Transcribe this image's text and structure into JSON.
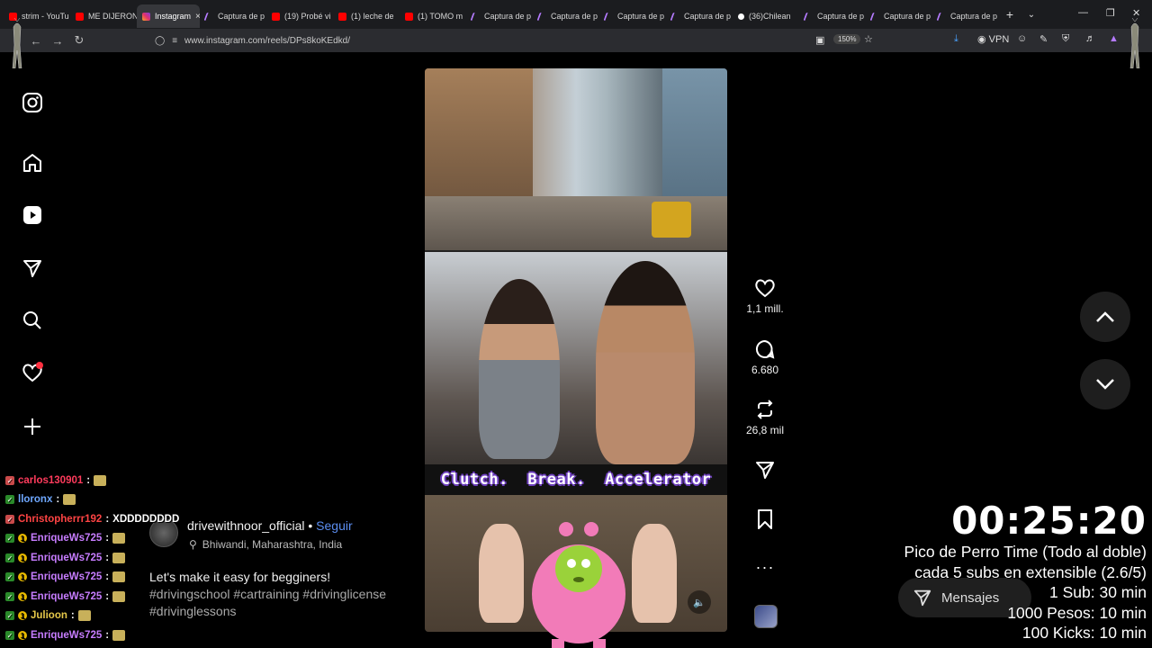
{
  "browser": {
    "tabs": [
      {
        "title": "strim - YouTu",
        "icon": "youtube-icon",
        "kind": "yt"
      },
      {
        "title": "ME DIJERON",
        "icon": "youtube-icon",
        "kind": "yt"
      },
      {
        "title": "Instagram",
        "icon": "instagram-icon",
        "kind": "ig",
        "active": true
      },
      {
        "title": "Captura de p",
        "icon": "pen-icon",
        "kind": "pen"
      },
      {
        "title": "(19) Probé vi",
        "icon": "youtube-icon",
        "kind": "yt"
      },
      {
        "title": "(1) leche de",
        "icon": "youtube-icon",
        "kind": "yt"
      },
      {
        "title": "(1) TOMO m",
        "icon": "youtube-icon",
        "kind": "yt"
      },
      {
        "title": "Captura de p",
        "icon": "pen-icon",
        "kind": "pen"
      },
      {
        "title": "Captura de p",
        "icon": "pen-icon",
        "kind": "pen"
      },
      {
        "title": "Captura de p",
        "icon": "pen-icon",
        "kind": "pen"
      },
      {
        "title": "Captura de p",
        "icon": "pen-icon",
        "kind": "pen"
      },
      {
        "title": "(36)Chilean",
        "icon": "tiktok-icon",
        "kind": "tt"
      },
      {
        "title": "Captura de p",
        "icon": "pen-icon",
        "kind": "pen"
      },
      {
        "title": "Captura de p",
        "icon": "pen-icon",
        "kind": "pen"
      },
      {
        "title": "Captura de p",
        "icon": "pen-icon",
        "kind": "pen"
      }
    ],
    "url": "www.instagram.com/reels/DPs8koKEdkd/",
    "zoom": "150%",
    "vpn_label": "VPN"
  },
  "reel": {
    "caption_overlay": "Clutch.  Break.  Accelerator",
    "likes": "1,1 mill.",
    "comments": "6.680",
    "reposts": "26,8 mil"
  },
  "post": {
    "author": "drivewithnoor_official",
    "separator": " • ",
    "follow_label": "Seguir",
    "location": "Bhiwandi, Maharashtra, India",
    "text": "Let's make it easy for begginers!",
    "hashtags": "#drivingschool #cartraining #drivinglicense #drivinglessons"
  },
  "messages_label": "Mensajes",
  "chat": [
    {
      "user": "carlos130901",
      "color": "#ff3b5c",
      "msg": "",
      "badge": "red"
    },
    {
      "user": "lloronx",
      "color": "#6fa8ff",
      "msg": "",
      "badge": "green"
    },
    {
      "user": "Christopherrr192",
      "color": "#ff4444",
      "msg": "XDDDDDDDD",
      "badge": "red"
    },
    {
      "user": "EnriqueWs725",
      "color": "#c77dff",
      "msg": "",
      "badge": "green"
    },
    {
      "user": "EnriqueWs725",
      "color": "#c77dff",
      "msg": "",
      "badge": "green"
    },
    {
      "user": "EnriqueWs725",
      "color": "#c77dff",
      "msg": "",
      "badge": "green"
    },
    {
      "user": "EnriqueWs725",
      "color": "#c77dff",
      "msg": "",
      "badge": "green"
    },
    {
      "user": "Julioon",
      "color": "#e6c84a",
      "msg": "",
      "badge": "green"
    },
    {
      "user": "EnriqueWs725",
      "color": "#c77dff",
      "msg": "",
      "badge": "green"
    }
  ],
  "timer": {
    "clock": "00:25:20",
    "lines": [
      "Pico de Perro Time (Todo al doble)",
      "cada 5 subs en extensible (2.6/5)",
      "1 Sub: 30 min",
      "1000 Pesos: 10 min",
      "100 Kicks: 10 min"
    ]
  },
  "colors": {
    "accent_follow": "#5b8def",
    "notification_dot": "#ff3040",
    "caption_outline": "#6e3fbf"
  }
}
